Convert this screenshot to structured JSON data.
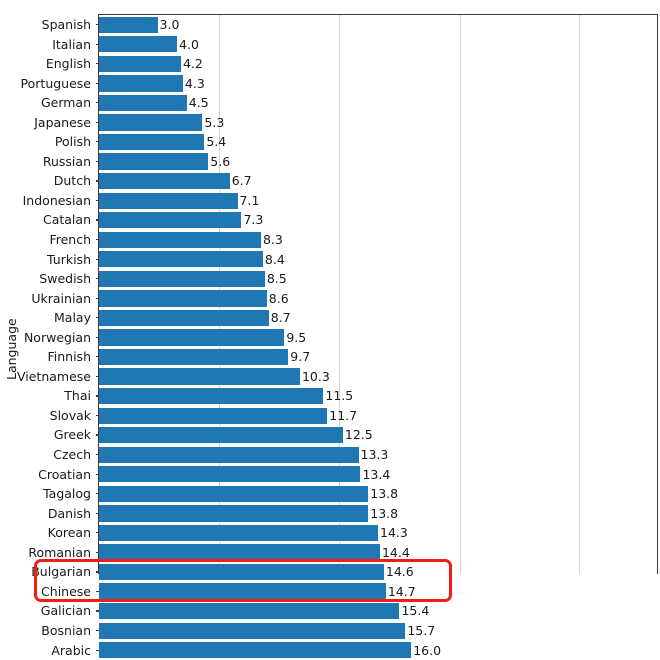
{
  "chart_data": {
    "type": "bar",
    "orientation": "horizontal",
    "title": "",
    "xlabel": "",
    "ylabel": "Language",
    "grid": true,
    "legend": null,
    "xlim": [
      0,
      28.7
    ],
    "x_gridlines": [
      6.15,
      12.3,
      18.5,
      24.6
    ],
    "value_label_format": "one-decimal",
    "categories": [
      "Spanish",
      "Italian",
      "English",
      "Portuguese",
      "German",
      "Japanese",
      "Polish",
      "Russian",
      "Dutch",
      "Indonesian",
      "Catalan",
      "French",
      "Turkish",
      "Swedish",
      "Ukrainian",
      "Malay",
      "Norwegian",
      "Finnish",
      "Vietnamese",
      "Thai",
      "Slovak",
      "Greek",
      "Czech",
      "Croatian",
      "Tagalog",
      "Danish",
      "Korean",
      "Romanian",
      "Bulgarian",
      "Chinese",
      "Galician",
      "Bosnian",
      "Arabic"
    ],
    "values": [
      3.0,
      4.0,
      4.2,
      4.3,
      4.5,
      5.3,
      5.4,
      5.6,
      6.7,
      7.1,
      7.3,
      8.3,
      8.4,
      8.5,
      8.6,
      8.7,
      9.5,
      9.7,
      10.3,
      11.5,
      11.7,
      12.5,
      13.3,
      13.4,
      13.8,
      13.8,
      14.3,
      14.4,
      14.6,
      14.7,
      15.4,
      15.7,
      16.0
    ],
    "value_labels": [
      "3.0",
      "4.0",
      "4.2",
      "4.3",
      "4.5",
      "5.3",
      "5.4",
      "5.6",
      "6.7",
      "7.1",
      "7.3",
      "8.3",
      "8.4",
      "8.5",
      "8.6",
      "8.7",
      "9.5",
      "9.7",
      "10.3",
      "11.5",
      "11.7",
      "12.5",
      "13.3",
      "13.4",
      "13.8",
      "13.8",
      "14.3",
      "14.4",
      "14.6",
      "14.7",
      "15.4",
      "15.7",
      "16.0"
    ],
    "bar_color": "#1f77b4",
    "annotations": [
      {
        "kind": "highlight-rectangle",
        "color": "#f01e14",
        "covers": [
          "Bulgarian",
          "Chinese"
        ]
      }
    ]
  }
}
